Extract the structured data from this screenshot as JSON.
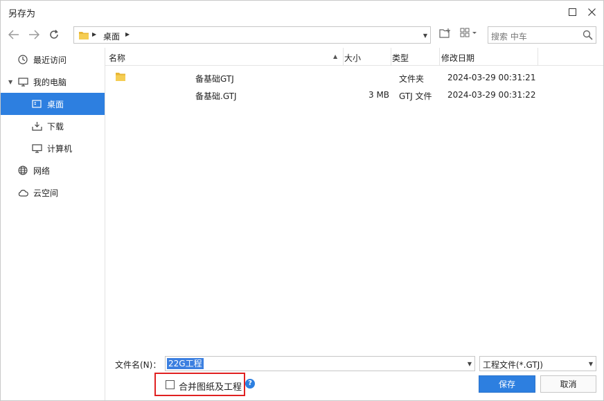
{
  "window": {
    "title": "另存为"
  },
  "toolbar": {
    "address_path": "桌面",
    "search_placeholder": "搜索 中车"
  },
  "sidebar": {
    "items": [
      {
        "label": "最近访问",
        "icon": "clock-icon"
      },
      {
        "label": "我的电脑",
        "icon": "computer-icon"
      },
      {
        "label": "桌面",
        "icon": "desktop-icon",
        "active": true
      },
      {
        "label": "下载",
        "icon": "download-icon"
      },
      {
        "label": "计算机",
        "icon": "monitor-icon"
      },
      {
        "label": "网络",
        "icon": "globe-icon"
      },
      {
        "label": "云空间",
        "icon": "cloud-icon"
      }
    ]
  },
  "list": {
    "columns": {
      "name": "名称",
      "size": "大小",
      "type": "类型",
      "modified": "修改日期"
    },
    "rows": [
      {
        "name": "备基础GTJ",
        "size": "",
        "type": "文件夹",
        "modified": "2024-03-29 00:31:21",
        "icon": "folder-icon"
      },
      {
        "name": "备基础.GTJ",
        "size": "3 MB",
        "type": "GTJ 文件",
        "modified": "2024-03-29 00:31:22",
        "icon": ""
      }
    ]
  },
  "bottom": {
    "filename_label": "文件名(N)：",
    "filename_value": "22G工程",
    "filetype_value": "工程文件(*.GTJ)",
    "merge_label": "合并图纸及工程",
    "help_glyph": "?",
    "save_label": "保存",
    "cancel_label": "取消"
  },
  "colors": {
    "accent": "#2d7fe0",
    "highlight_border": "#e02020"
  }
}
